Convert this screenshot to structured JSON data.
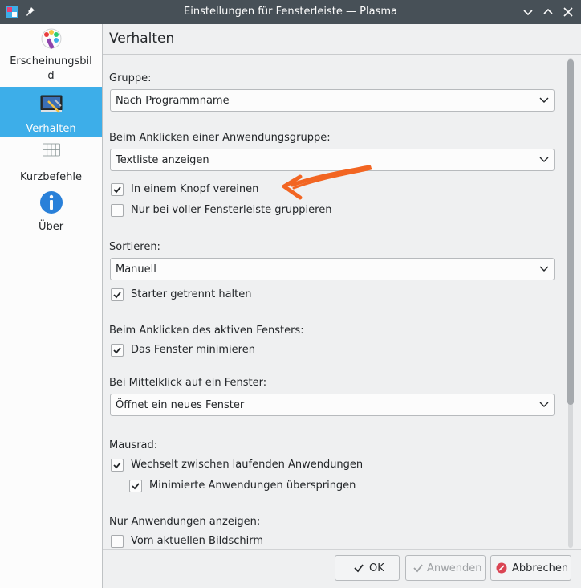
{
  "window": {
    "title": "Einstellungen für Fensterleiste — Plasma"
  },
  "sidebar": {
    "items": [
      {
        "label_line1": "Erscheinungsbil",
        "label_line2": "d",
        "icon": "appearance-icon"
      },
      {
        "label": "Verhalten",
        "icon": "behavior-icon",
        "selected": true
      },
      {
        "label": "Kurzbefehle",
        "icon": "keyboard-icon"
      },
      {
        "label": "Über",
        "icon": "info-icon"
      }
    ]
  },
  "page": {
    "title": "Verhalten",
    "group_label": "Gruppe:",
    "group_value": "Nach Programmname",
    "click_group_label": "Beim Anklicken einer Anwendungsgruppe:",
    "click_group_value": "Textliste anzeigen",
    "combine_label": "In einem Knopf vereinen",
    "combine_checked": true,
    "group_full_label": "Nur bei voller Fensterleiste gruppieren",
    "group_full_checked": false,
    "sort_label": "Sortieren:",
    "sort_value": "Manuell",
    "launchers_label": "Starter getrennt halten",
    "launchers_checked": true,
    "active_click_label": "Beim Anklicken des aktiven Fensters:",
    "minimize_label": "Das Fenster minimieren",
    "minimize_checked": true,
    "middle_click_label": "Bei Mittelklick auf ein Fenster:",
    "middle_click_value": "Öffnet ein neues Fenster",
    "wheel_label": "Mausrad:",
    "wheel_cycle_label": "Wechselt zwischen laufenden Anwendungen",
    "wheel_cycle_checked": true,
    "skip_minimized_label": "Minimierte Anwendungen überspringen",
    "skip_minimized_checked": true,
    "only_show_label": "Nur Anwendungen anzeigen:",
    "current_screen_label": "Vom aktuellen Bildschirm",
    "current_screen_checked": false
  },
  "buttons": {
    "ok": "OK",
    "apply": "Anwenden",
    "cancel": "Abbrechen"
  },
  "colors": {
    "accent": "#3daee9",
    "titlebar": "#475057",
    "annotation": "#f26522"
  }
}
